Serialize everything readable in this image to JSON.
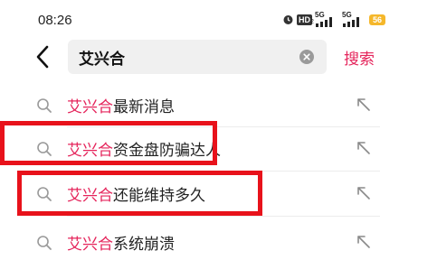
{
  "status_bar": {
    "time": "08:26",
    "hd_label": "HD",
    "hd_sub": "2",
    "signal_1_label": "5G",
    "signal_2_label": "5G",
    "battery_label": "56"
  },
  "search": {
    "query": "艾兴合",
    "submit_label": "搜索"
  },
  "suggestions": [
    {
      "highlight": "艾兴合",
      "rest": "最新消息"
    },
    {
      "highlight": "艾兴合",
      "rest": "资金盘防骗达人"
    },
    {
      "highlight": "艾兴合",
      "rest": "还能维持多久"
    },
    {
      "highlight": "艾兴合",
      "rest": "系统崩溃"
    }
  ],
  "colors": {
    "accent": "#e5245b",
    "annotation": "#e8121b",
    "search_bg": "#f0f0f0"
  },
  "icons": [
    "back-arrow-icon",
    "clear-icon",
    "search-icon",
    "fill-arrow-icon",
    "alarm-icon",
    "signal-icon",
    "battery-icon"
  ]
}
